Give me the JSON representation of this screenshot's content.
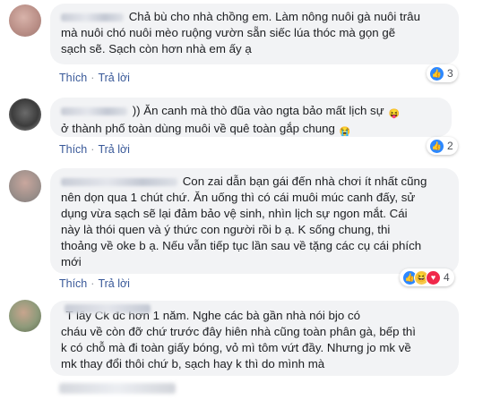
{
  "comments": [
    {
      "text": "Chả bù cho nhà chồng em. Làm nông nuôi gà nuôi trâu mà nuôi chó nuôi mèo ruộng vườn sẵn siếc lúa thóc mà gọn gẽ sạch sẽ. Sạch còn hơn nhà em ấy ạ",
      "line1": "Chả bù cho nhà chồng em. Làm nông nuôi gà nuôi trâu",
      "line2": "mà nuôi chó nuôi mèo ruộng vườn sẵn siếc lúa thóc mà gọn gẽ",
      "line3": "sạch sẽ. Sạch còn hơn nhà em ấy ạ",
      "like_label": "Thích",
      "reply_label": "Trả lời",
      "reaction_count": "3",
      "reaction_icons": [
        "like-icon"
      ]
    },
    {
      "line1": ")) Ăn canh mà thò đũa vào ngta bảo mất lịch sự",
      "line2": "ở thành phố toàn dùng muôi về quê toàn gắp chung",
      "emoji1": "😝",
      "emoji2": "😭",
      "like_label": "Thích",
      "reply_label": "Trả lời",
      "reaction_count": "2",
      "reaction_icons": [
        "like-icon"
      ]
    },
    {
      "line1": "Con zai dẫn bạn gái đến nhà chơi ít nhất cũng",
      "line2": "nên dọn qua 1 chút chứ. Ăn uống thì có cái muôi múc canh đấy, sử",
      "line3": "dụng vừa sạch sẽ lại đảm bảo vệ sinh, nhìn lịch sự ngon mắt. Cái",
      "line4": "này là thói quen và ý thức con người rồi b ạ. K sống chung, thi",
      "line5": "thoảng về oke b ạ. Nếu vẫn tiếp tục lần sau về tặng các cụ cái phích",
      "line6": "mới",
      "like_label": "Thích",
      "reply_label": "Trả lời",
      "reaction_count": "4",
      "reaction_icons": [
        "like-icon",
        "haha-icon",
        "love-icon"
      ]
    },
    {
      "line1": "T lấy Ck đc hơn 1 năm. Nghe các bà gần nhà nói bjo có",
      "line2": "cháu về còn đỡ chứ trước đây hiên nhà cũng toàn phân gà, bếp thì",
      "line3": "k có chỗ mà đi toàn giấy bóng, vỏ mì tôm vứt đầy. Nhưng jo mk về",
      "line4": "mk thay đổi thôi chứ b, sạch hay k thì do mình mà"
    }
  ],
  "colors": {
    "bubble": "#f2f3f5",
    "link": "#385898",
    "like": "#2d88ff"
  }
}
